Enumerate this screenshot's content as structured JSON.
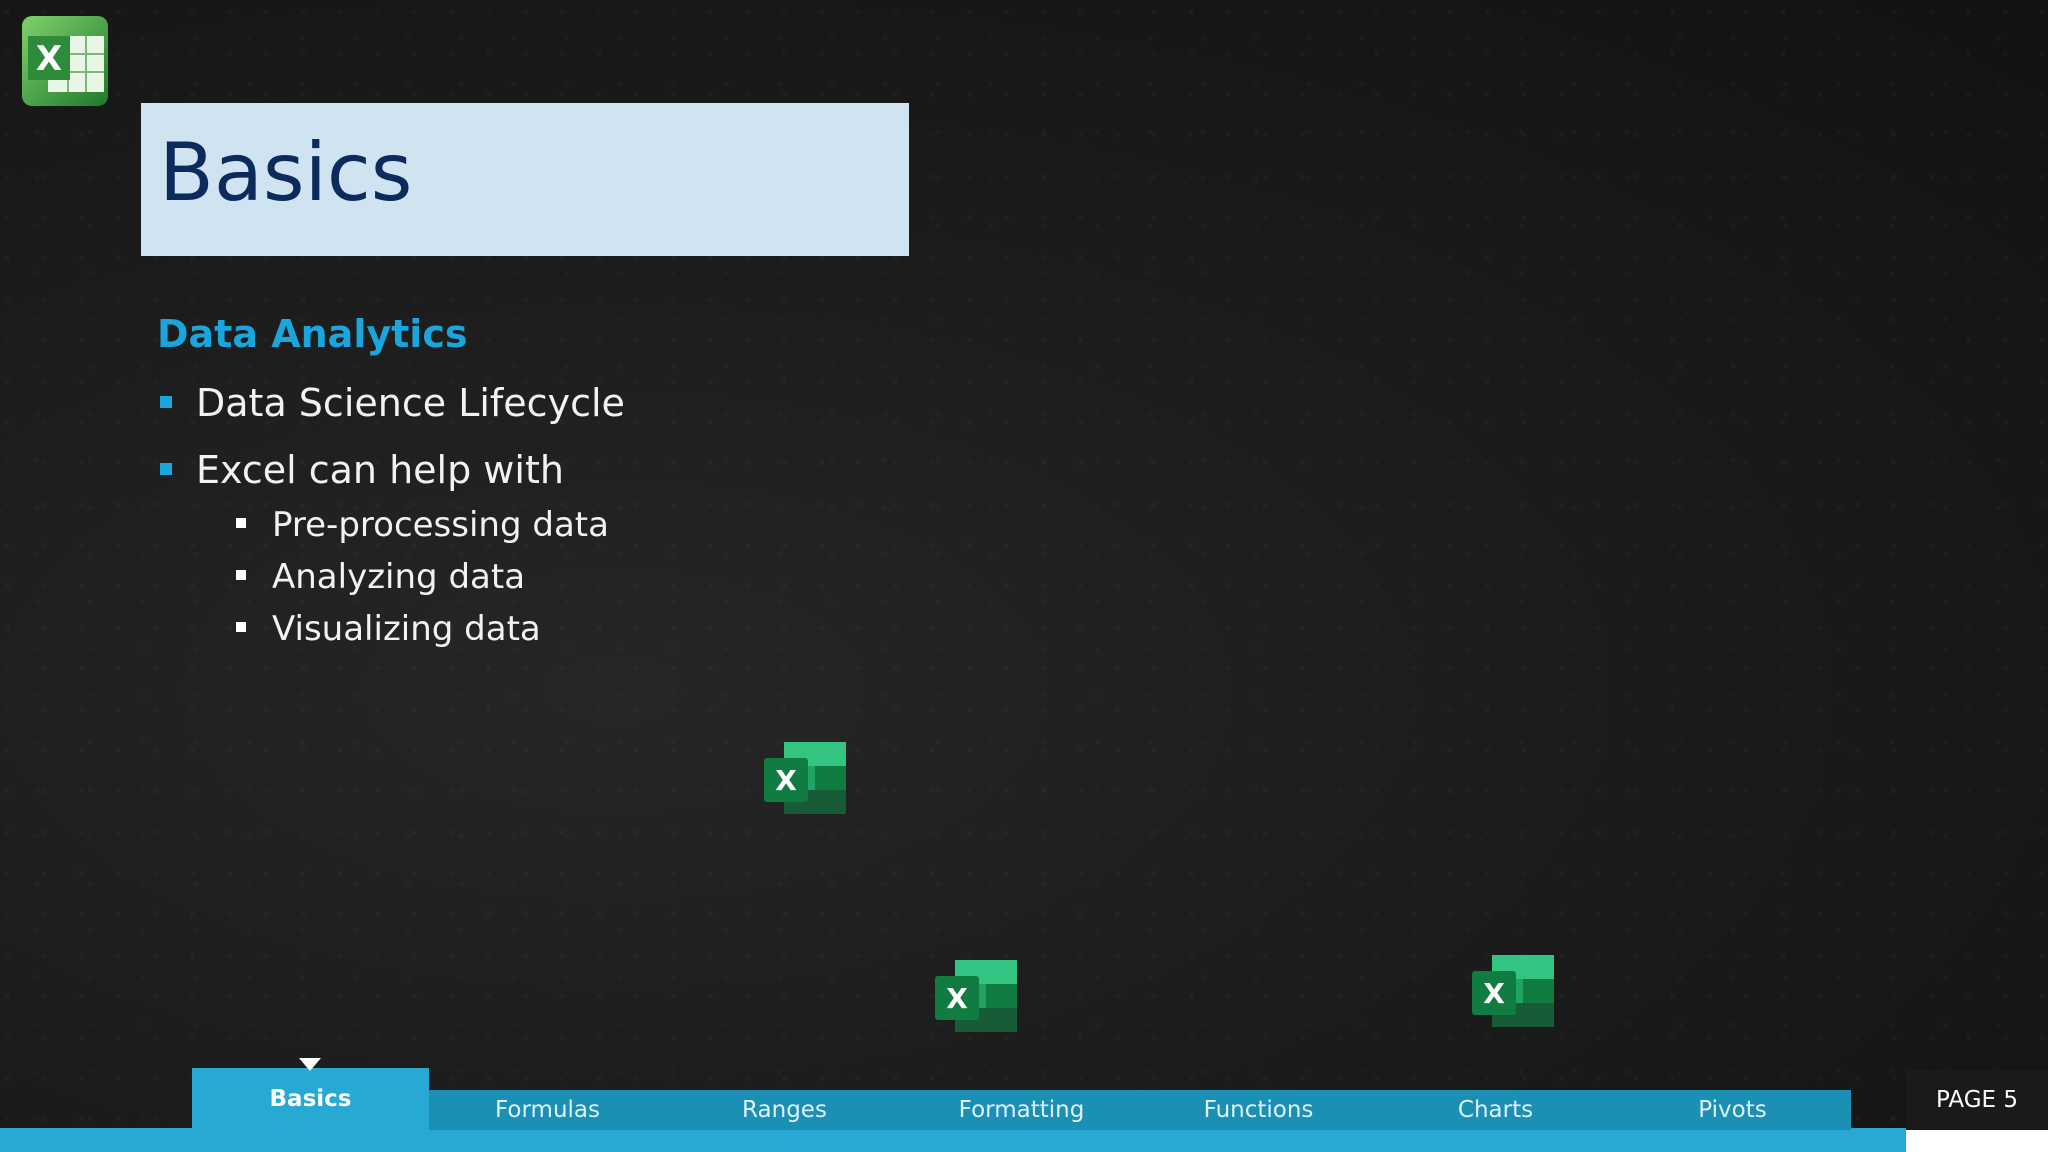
{
  "slide": {
    "title": "Basics",
    "heading": "Data Analytics",
    "bullets": [
      "Data Science Lifecycle",
      "Excel can help with"
    ],
    "sub_bullets": [
      "Pre-processing data",
      "Analyzing data",
      "Visualizing data"
    ]
  },
  "nav": {
    "items": [
      "Basics",
      "Formulas",
      "Ranges",
      "Formatting",
      "Functions",
      "Charts",
      "Pivots"
    ],
    "active": "Basics"
  },
  "page": {
    "label": "PAGE 5"
  },
  "icons": {
    "logo": "excel-classic-logo-icon",
    "app": "excel-app-icon"
  },
  "colors": {
    "title_bg": "#cfe3f1",
    "title_text": "#0d2a5c",
    "accent": "#1aa6dd",
    "nav_bar": "#1b8fb4",
    "excel_green": "#1d6f42"
  }
}
